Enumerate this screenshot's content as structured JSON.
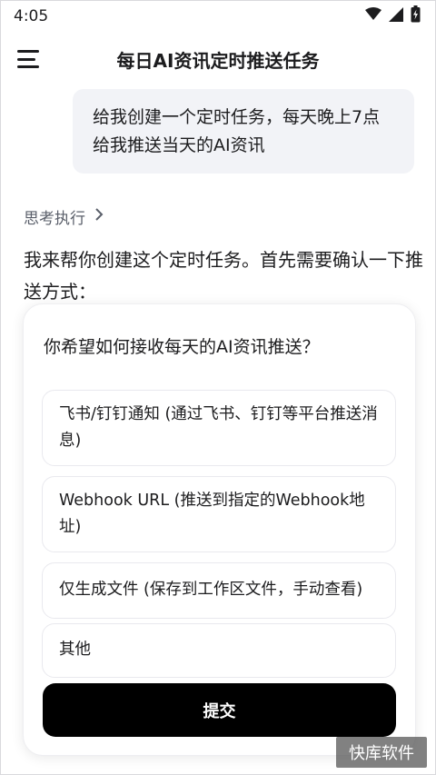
{
  "status_bar": {
    "time": "4:05",
    "icons": [
      "wifi-icon",
      "signal-icon",
      "battery-icon"
    ]
  },
  "header": {
    "title": "每日AI资讯定时推送任务",
    "menu_icon": "menu-icon"
  },
  "chat": {
    "user_message": "给我创建一个定时任务，每天晚上7点给我推送当天的AI资讯",
    "thinking_label": "思考执行",
    "assistant_message": "我来帮你创建这个定时任务。首先需要确认一下推送方式："
  },
  "question_card": {
    "question": "你希望如何接收每天的AI资讯推送？",
    "options": [
      {
        "label": "飞书/钉钉通知 (通过飞书、钉钉等平台推送消息)"
      },
      {
        "label": "Webhook URL (推送到指定的Webhook地址)"
      },
      {
        "label": "仅生成文件 (保存到工作区文件，手动查看)"
      },
      {
        "label": "其他"
      }
    ],
    "submit_label": "提交"
  },
  "watermark": "快库软件",
  "colors": {
    "background": "#ffffff",
    "bubble": "#f2f3f7",
    "submit_bg": "#000000",
    "muted_text": "#5a5f6a"
  }
}
